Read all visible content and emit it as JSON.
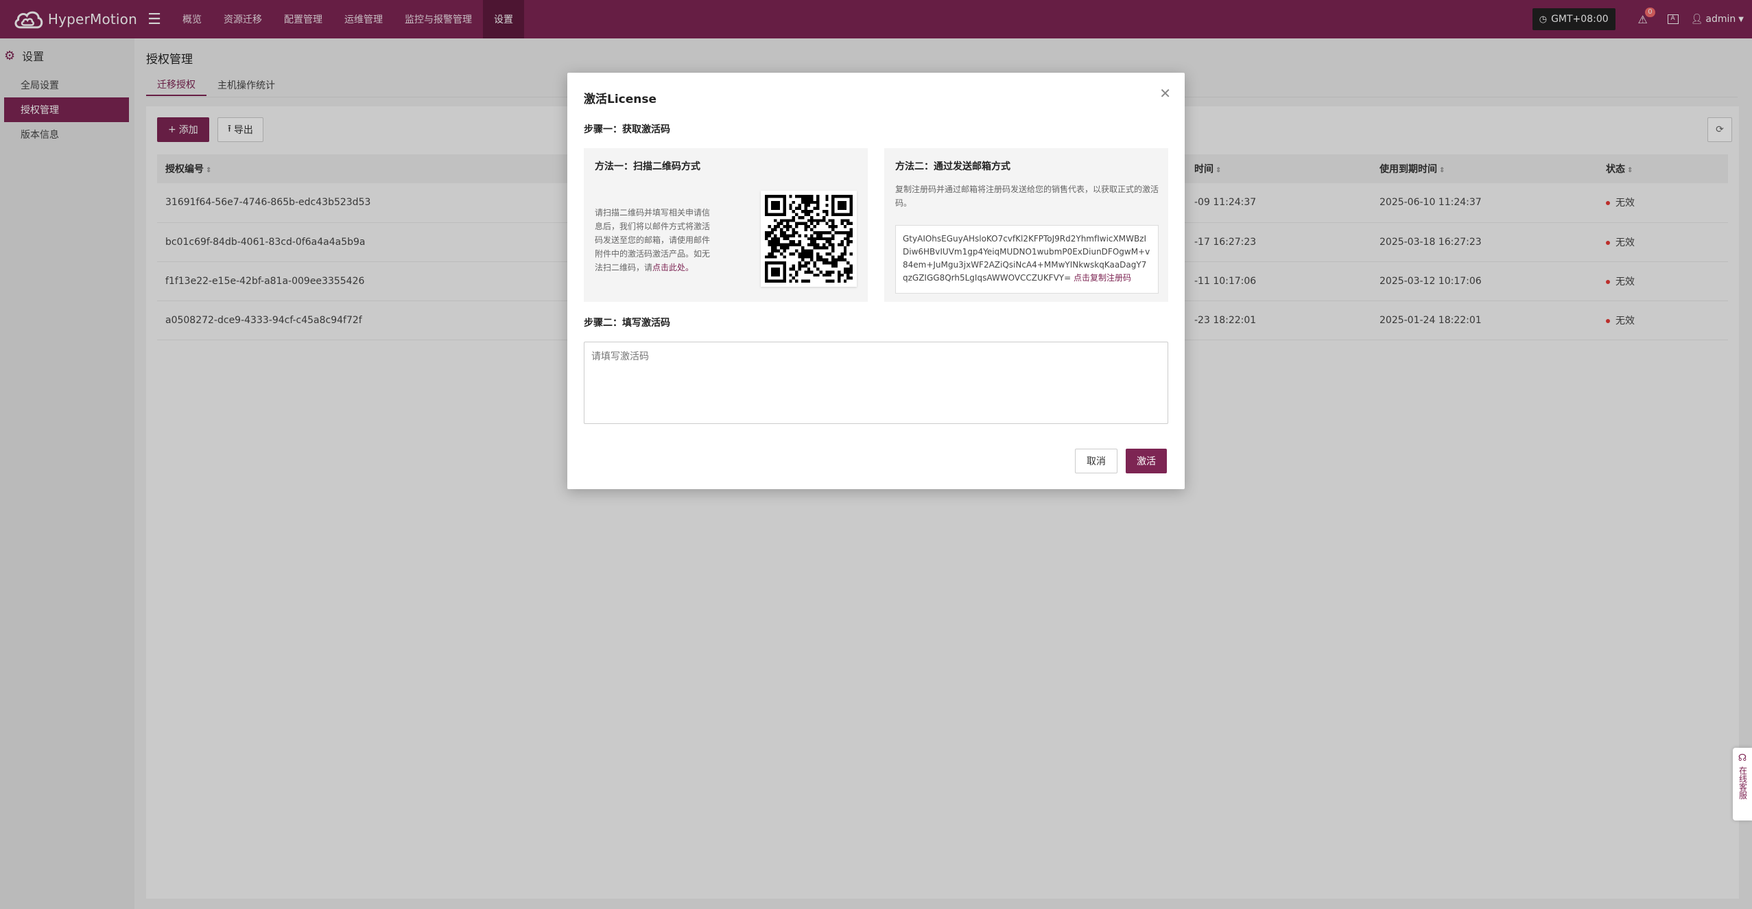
{
  "app": {
    "name": "HyperMotion"
  },
  "nav": [
    "概览",
    "资源迁移",
    "配置管理",
    "运维管理",
    "监控与报警管理",
    "设置"
  ],
  "topbar": {
    "timezone": "GMT+08:00",
    "alert_count": "0",
    "user": "admin"
  },
  "sidebar": {
    "title": "设置",
    "items": [
      {
        "label": "全局设置"
      },
      {
        "label": "授权管理"
      },
      {
        "label": "版本信息"
      }
    ]
  },
  "page": {
    "title": "授权管理",
    "tabs": [
      "迁移授权",
      "主机操作统计"
    ]
  },
  "toolbar": {
    "add_label": "添加",
    "export_label": "导出"
  },
  "table": {
    "columns": [
      "授权编号",
      "时间",
      "使用到期时间",
      "状态"
    ],
    "rows": [
      {
        "id": "31691f64-56e7-4746-865b-edc43b523d53",
        "time": "-09 11:24:37",
        "expire": "2025-06-10 11:24:37",
        "status": "无效"
      },
      {
        "id": "bc01c69f-84db-4061-83cd-0f6a4a4a5b9a",
        "time": "-17 16:27:23",
        "expire": "2025-03-18 16:27:23",
        "status": "无效"
      },
      {
        "id": "f1f13e22-e15e-42bf-a81a-009ee3355426",
        "time": "-11 10:17:06",
        "expire": "2025-03-12 10:17:06",
        "status": "无效"
      },
      {
        "id": "a0508272-dce9-4333-94cf-c45a8c94f72f",
        "time": "-23 18:22:01",
        "expire": "2025-01-24 18:22:01",
        "status": "无效"
      }
    ]
  },
  "modal": {
    "title": "激活License",
    "step1": "步骤一：获取激活码",
    "method1_title": "方法一：扫描二维码方式",
    "method1_text": "请扫描二维码并填写相关申请信息后，我们将以邮件方式将激活码发送至您的邮箱，请使用邮件附件中的激活码激活产品。如无法扫二维码，请",
    "method1_link": "点击此处。",
    "method2_title": "方法二：通过发送邮箱方式",
    "method2_text": "复制注册码并通过邮箱将注册码发送给您的销售代表，以获取正式的激活码。",
    "reg_code": "GtyAIOhsEGuyAHsloKO7cvfKl2KFPToJ9Rd2YhmfIwicXMWBzIDiw6HBvIUVm1gp4YeiqMUDNO1wubmP0ExDiunDFOgwM+v84em+JuMgu3jxWF2AZiQsiNcA4+MMwYINkwskqKaaDagY7qzGZIGG8Qrh5LgIqsAWWOVCCZUKFVY=",
    "copy_link": "点击复制注册码",
    "step2": "步骤二：填写激活码",
    "placeholder": "请填写激活码",
    "cancel": "取消",
    "activate": "激活"
  },
  "service": "在线客服",
  "colors": {
    "brand": "#7d2553",
    "status_invalid": "#e53935"
  }
}
